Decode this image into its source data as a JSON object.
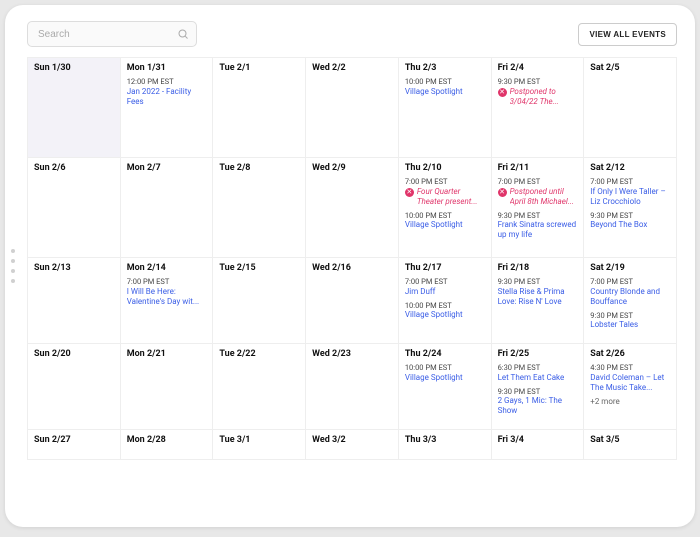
{
  "search": {
    "placeholder": "Search"
  },
  "topbar": {
    "view_all": "VIEW ALL EVENTS"
  },
  "weeks": [
    {
      "row_class": "tall",
      "days": [
        {
          "label": "Sun 1/30",
          "shaded": true,
          "events": []
        },
        {
          "label": "Mon 1/31",
          "events": [
            {
              "time": "12:00 PM EST",
              "title": "Jan 2022 - Facility Fees"
            }
          ]
        },
        {
          "label": "Tue 2/1",
          "events": []
        },
        {
          "label": "Wed 2/2",
          "events": []
        },
        {
          "label": "Thu 2/3",
          "events": [
            {
              "time": "10:00 PM EST",
              "title": "Village Spotlight"
            }
          ]
        },
        {
          "label": "Fri 2/4",
          "events": [
            {
              "time": "9:30 PM EST",
              "title": "Postponed to 3/04/22 The...",
              "cancelled": true
            }
          ]
        },
        {
          "label": "Sat 2/5",
          "events": []
        }
      ]
    },
    {
      "row_class": "tall",
      "days": [
        {
          "label": "Sun 2/6",
          "events": []
        },
        {
          "label": "Mon 2/7",
          "events": []
        },
        {
          "label": "Tue 2/8",
          "events": []
        },
        {
          "label": "Wed 2/9",
          "events": []
        },
        {
          "label": "Thu 2/10",
          "events": [
            {
              "time": "7:00 PM EST",
              "title": "Four Quarter Theater present...",
              "cancelled": true
            },
            {
              "time": "10:00 PM EST",
              "title": "Village Spotlight"
            }
          ]
        },
        {
          "label": "Fri 2/11",
          "events": [
            {
              "time": "7:00 PM EST",
              "title": "Postponed until April 8th Michael...",
              "cancelled": true
            },
            {
              "time": "9:30 PM EST",
              "title": "Frank Sinatra screwed up my life"
            }
          ]
        },
        {
          "label": "Sat 2/12",
          "events": [
            {
              "time": "7:00 PM EST",
              "title": "If Only I Were Taller – Liz Crocchiolo"
            },
            {
              "time": "9:30 PM EST",
              "title": "Beyond The Box"
            }
          ]
        }
      ]
    },
    {
      "row_class": "",
      "days": [
        {
          "label": "Sun 2/13",
          "events": []
        },
        {
          "label": "Mon 2/14",
          "events": [
            {
              "time": "7:00 PM EST",
              "title": "I Will Be Here: Valentine's Day wit..."
            }
          ]
        },
        {
          "label": "Tue 2/15",
          "events": []
        },
        {
          "label": "Wed 2/16",
          "events": []
        },
        {
          "label": "Thu 2/17",
          "events": [
            {
              "time": "7:00 PM EST",
              "title": "Jim Duff"
            },
            {
              "time": "10:00 PM EST",
              "title": "Village Spotlight"
            }
          ]
        },
        {
          "label": "Fri 2/18",
          "events": [
            {
              "time": "9:30 PM EST",
              "title": "Stella Rise & Prima Love: Rise N' Love"
            }
          ]
        },
        {
          "label": "Sat 2/19",
          "events": [
            {
              "time": "7:00 PM EST",
              "title": "Country Blonde and Bouffance"
            },
            {
              "time": "9:30 PM EST",
              "title": "Lobster Tales"
            }
          ]
        }
      ]
    },
    {
      "row_class": "",
      "days": [
        {
          "label": "Sun 2/20",
          "events": []
        },
        {
          "label": "Mon 2/21",
          "events": []
        },
        {
          "label": "Tue 2/22",
          "events": []
        },
        {
          "label": "Wed 2/23",
          "events": []
        },
        {
          "label": "Thu 2/24",
          "events": [
            {
              "time": "10:00 PM EST",
              "title": "Village Spotlight"
            }
          ]
        },
        {
          "label": "Fri 2/25",
          "events": [
            {
              "time": "6:30 PM EST",
              "title": "Let Them Eat Cake"
            },
            {
              "time": "9:30 PM EST",
              "title": "2 Gays, 1 Mic: The Show"
            }
          ]
        },
        {
          "label": "Sat 2/26",
          "more": "+2 more",
          "events": [
            {
              "time": "4:30 PM EST",
              "title": "David Coleman – Let The Music Take..."
            }
          ]
        }
      ]
    },
    {
      "row_class": "short final-row",
      "days": [
        {
          "label": "Sun 2/27",
          "events": []
        },
        {
          "label": "Mon 2/28",
          "events": []
        },
        {
          "label": "Tue 3/1",
          "events": []
        },
        {
          "label": "Wed 3/2",
          "events": []
        },
        {
          "label": "Thu 3/3",
          "events": []
        },
        {
          "label": "Fri 3/4",
          "events": []
        },
        {
          "label": "Sat 3/5",
          "events": []
        }
      ]
    }
  ]
}
